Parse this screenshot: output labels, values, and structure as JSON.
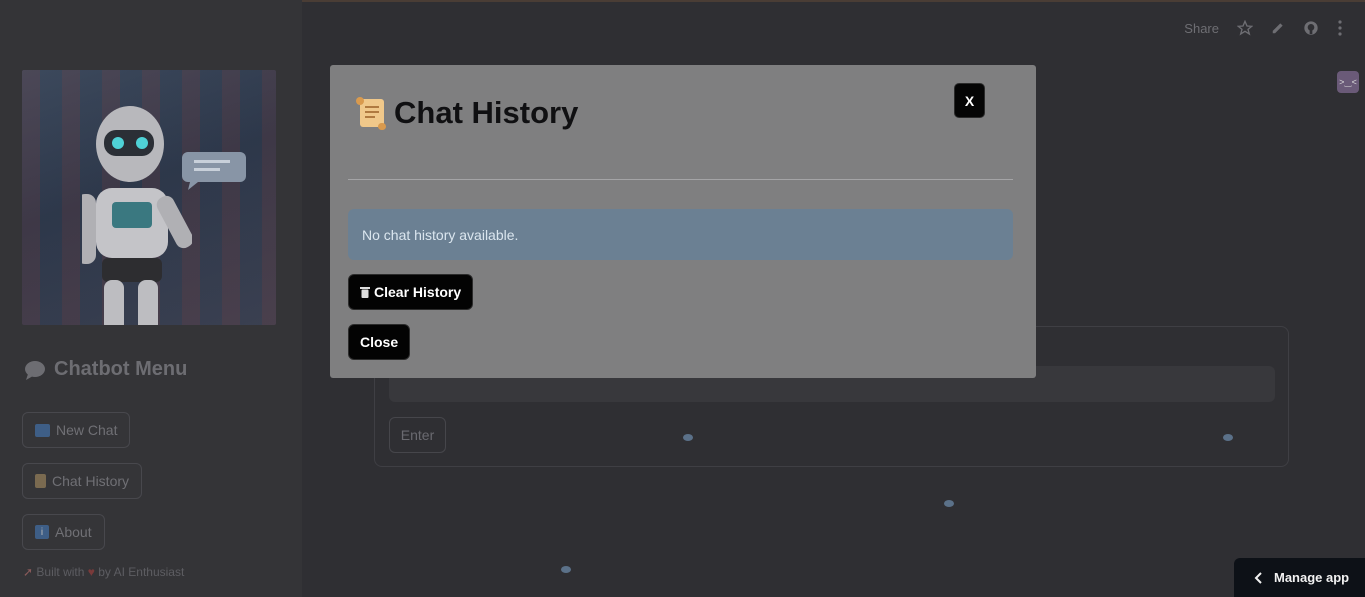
{
  "sidebar": {
    "title": "Chatbot Menu",
    "title_icon": "speech-bubble-icon",
    "buttons": [
      {
        "label": "New Chat",
        "icon": "new-icon"
      },
      {
        "label": "Chat History",
        "icon": "scroll-icon"
      },
      {
        "label": "About",
        "icon": "info-icon"
      }
    ],
    "footer": {
      "prefix": "Built with",
      "suffix": "by AI Enthusiast",
      "icons": [
        "rocket-icon",
        "heart-icon"
      ]
    }
  },
  "toolbar": {
    "share_label": "Share",
    "icons": [
      "star-icon",
      "pencil-icon",
      "github-icon",
      "more-vertical-icon"
    ]
  },
  "main": {
    "enter_label": "Enter"
  },
  "modal": {
    "title": "Chat History",
    "close_x_label": "X",
    "info_message": "No chat history available.",
    "clear_label": "Clear History",
    "close_label": "Close"
  },
  "manage_app": {
    "label": "Manage app"
  },
  "colors": {
    "background": "#2f2f33",
    "modal": "#7f7f80",
    "info": "#6b8093",
    "button": "#030303"
  }
}
